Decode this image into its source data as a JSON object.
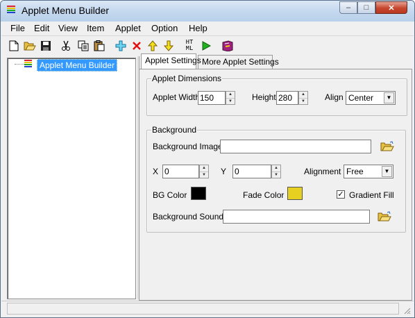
{
  "window": {
    "title": "Applet Menu Builder",
    "controls": {
      "minimize": "–",
      "maximize": "□",
      "close": "✕"
    },
    "icon": "app-stripes-icon"
  },
  "menu": [
    "File",
    "Edit",
    "View",
    "Item",
    "Applet",
    "Option",
    "Help"
  ],
  "toolbar": {
    "buttons": [
      {
        "name": "new-icon"
      },
      {
        "name": "open-icon"
      },
      {
        "name": "save-icon"
      },
      {
        "name": "cut-icon"
      },
      {
        "name": "copy-icon"
      },
      {
        "name": "paste-icon"
      },
      {
        "name": "add-icon"
      },
      {
        "name": "delete-icon"
      },
      {
        "name": "move-up-icon"
      },
      {
        "name": "move-down-icon"
      },
      {
        "name": "html-icon",
        "label": "HT ML"
      },
      {
        "name": "run-icon"
      },
      {
        "name": "help-book-icon"
      }
    ]
  },
  "tree": {
    "root_label": "Applet Menu Builder"
  },
  "tabs": [
    {
      "label": "Applet Settings",
      "active": true
    },
    {
      "label": "More Applet Settings",
      "active": false
    }
  ],
  "dimensions": {
    "legend": "Applet Dimensions",
    "width_label": "Applet Width",
    "width_value": "150",
    "height_label": "Height",
    "height_value": "280",
    "align_label": "Align",
    "align_value": "Center"
  },
  "background": {
    "legend": "Background",
    "image_label": "Background Image",
    "image_value": "",
    "x_label": "X",
    "x_value": "0",
    "y_label": "Y",
    "y_value": "0",
    "alignment_label": "Alignment",
    "alignment_value": "Free",
    "bg_color_label": "BG Color",
    "bg_color": "#000000",
    "fade_color_label": "Fade Color",
    "fade_color": "#e8d020",
    "gradient_label": "Gradient Fill",
    "gradient_checked": true,
    "sound_label": "Background Sound",
    "sound_value": ""
  },
  "colors": {
    "selection": "#3399ff",
    "title_bar": "#c5d9ef",
    "close_button": "#c6462e"
  }
}
